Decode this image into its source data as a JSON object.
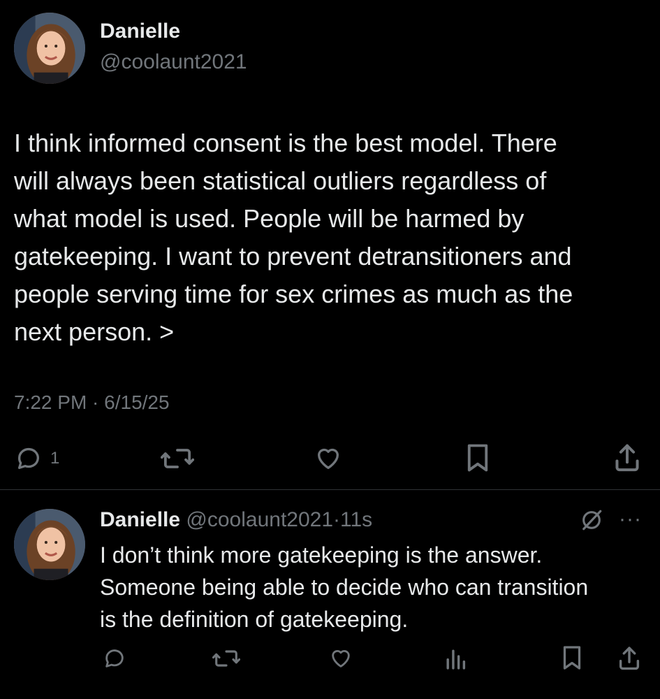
{
  "main_post": {
    "author_name": "Danielle",
    "author_handle": "@coolaunt2021",
    "text": "I think informed consent is the best model. There\nwill always been statistical outliers regardless of\nwhat model is used. People will be harmed by\ngatekeeping. I want to prevent detransitioners and\npeople serving time for sex crimes as much as the\nnext person. >",
    "timestamp": "7:22 PM · 6/15/25",
    "actions": {
      "reply_count": "1",
      "icons": [
        "reply-icon",
        "repost-icon",
        "like-icon",
        "bookmark-icon",
        "share-icon"
      ]
    }
  },
  "reply_post": {
    "author_name": "Danielle",
    "author_handle": "@coolaunt2021",
    "separator": "·",
    "time": "11s",
    "text": "I don’t think more gatekeeping is the answer.\nSomeone being able to decide who can transition\nis the definition of gatekeeping.",
    "more_label": "···",
    "actions": {
      "icons": [
        "reply-icon",
        "repost-icon",
        "like-icon",
        "views-icon",
        "bookmark-icon",
        "share-icon"
      ]
    }
  },
  "colors": {
    "background": "#000000",
    "primary_text": "#e7e9ea",
    "secondary_text": "#71767b",
    "divider": "#2f3336"
  }
}
